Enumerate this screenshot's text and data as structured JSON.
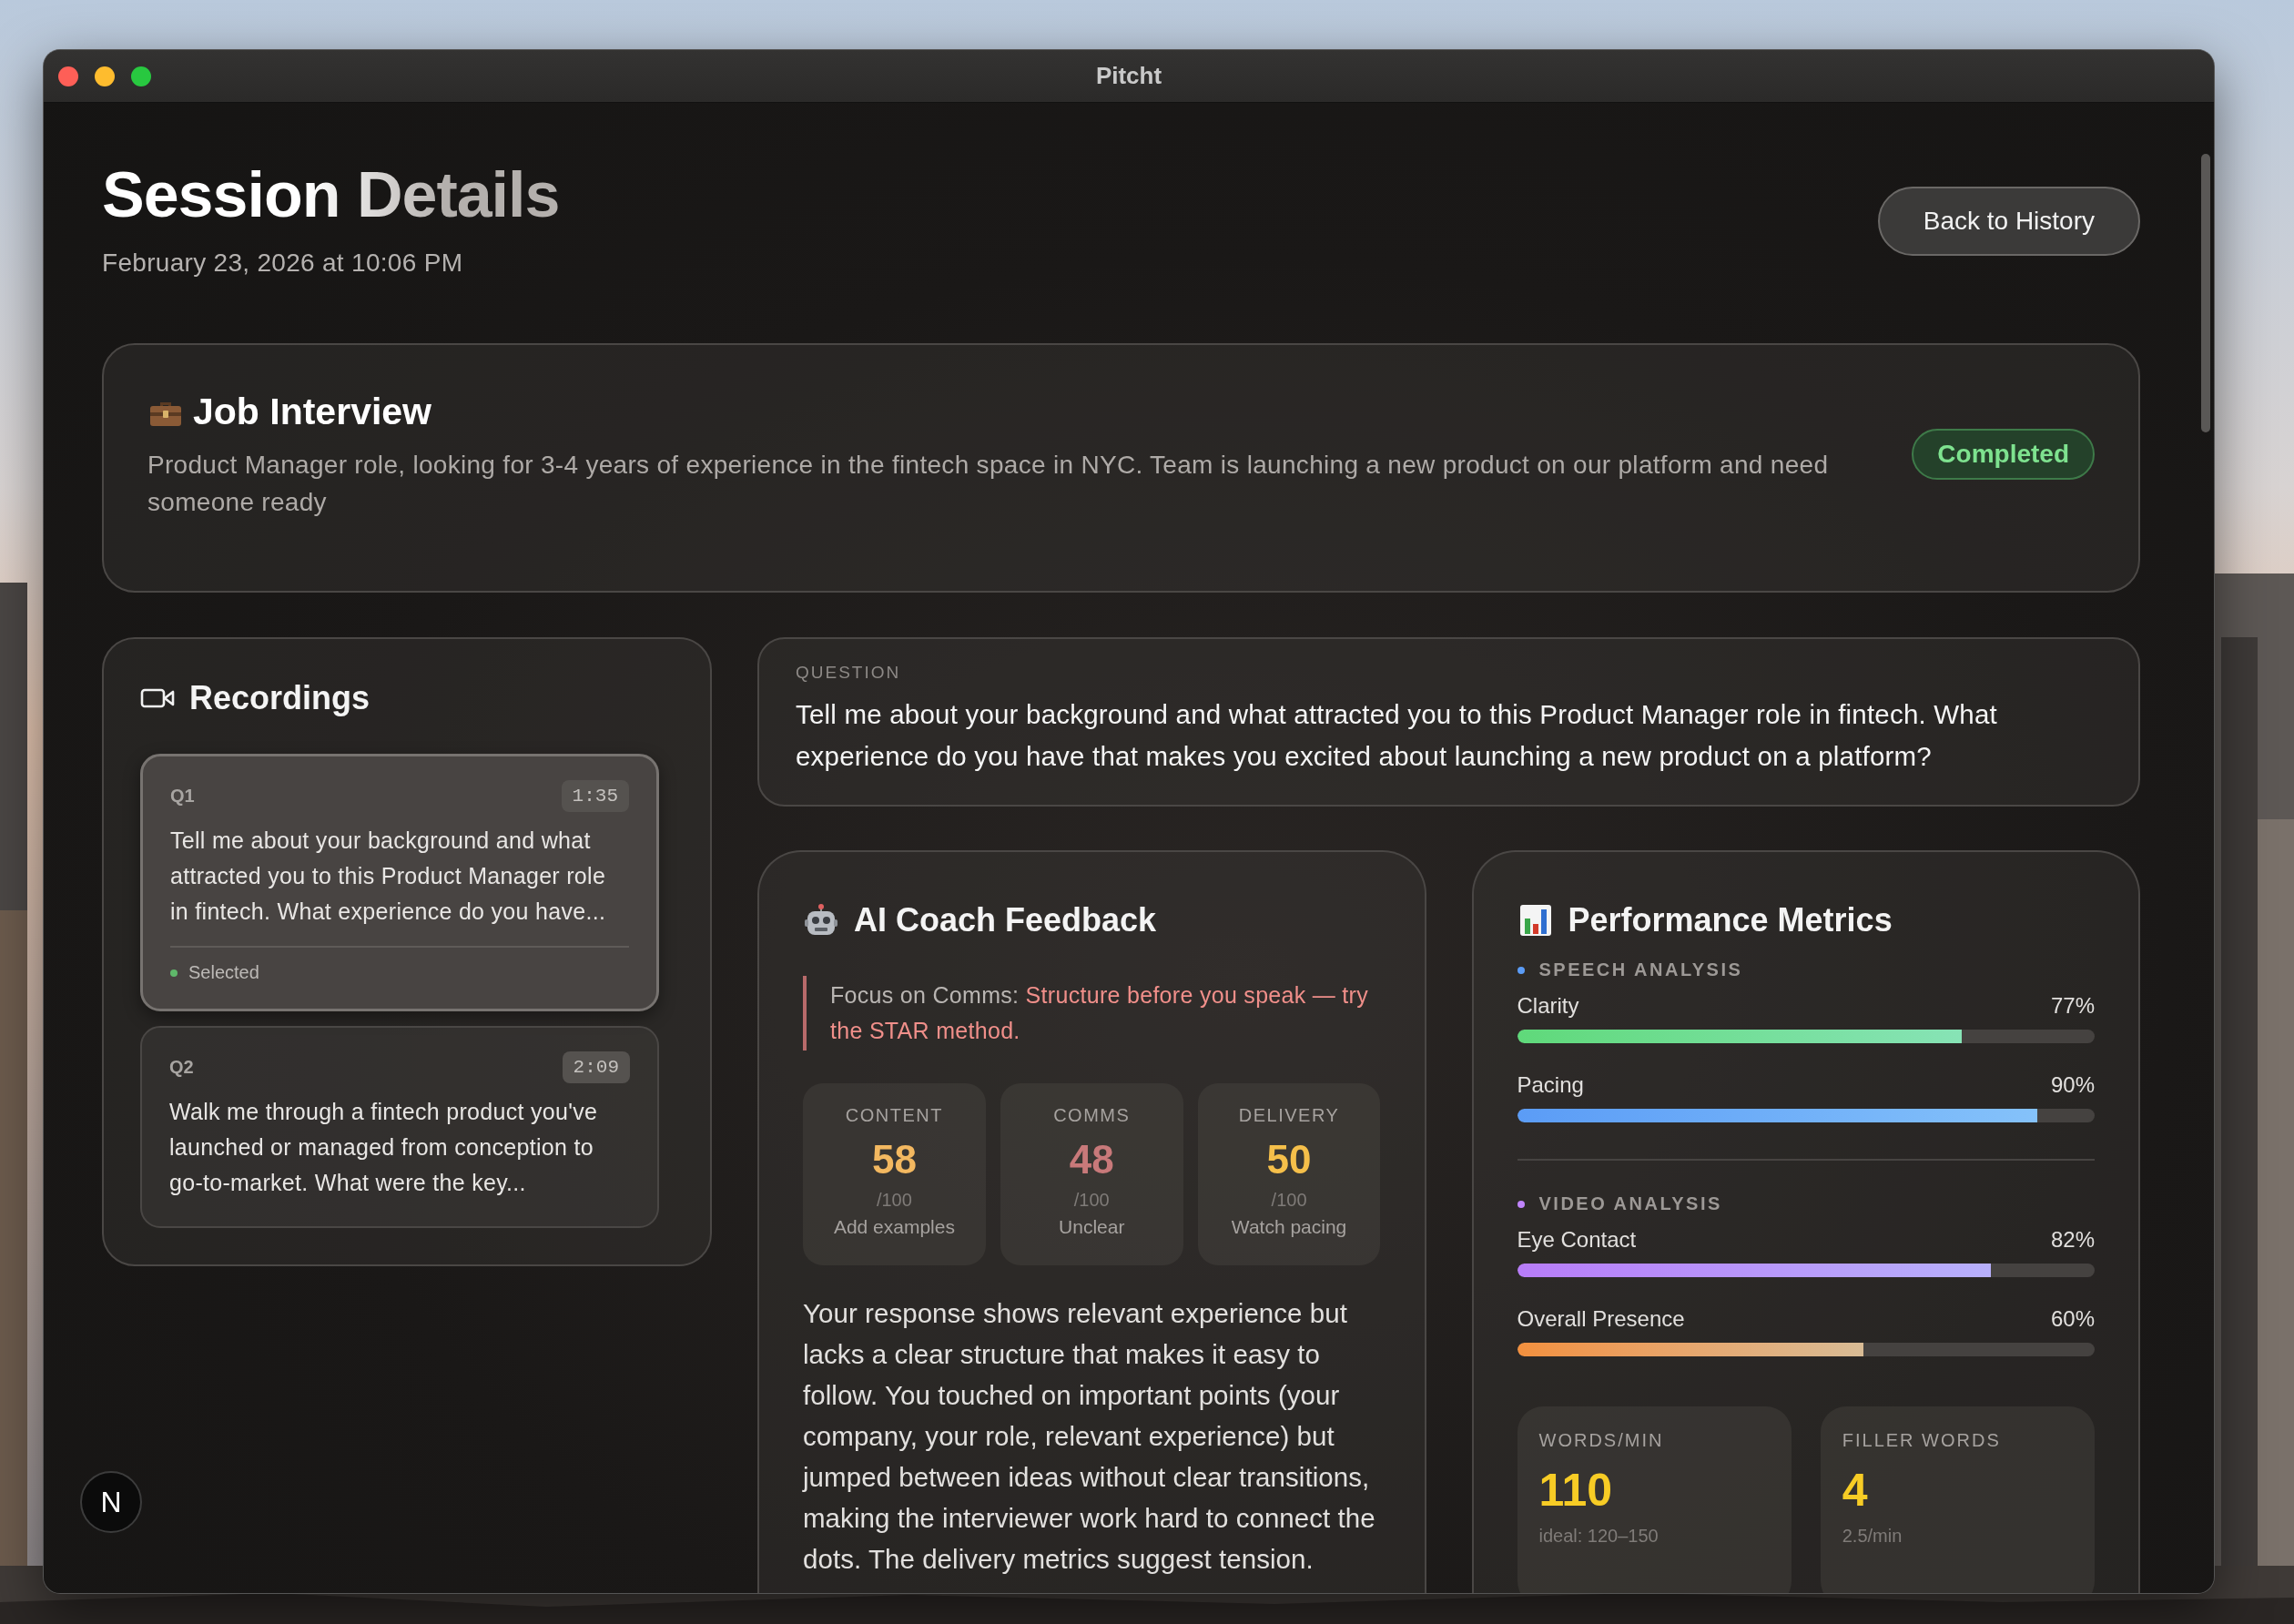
{
  "window": {
    "title": "Pitcht"
  },
  "header": {
    "title": "Session Details",
    "date": "February 23, 2026 at 10:06 PM",
    "back_button": "Back to History"
  },
  "session": {
    "title": "Job Interview",
    "description": "Product Manager role, looking for 3-4 years of experience in the fintech space in NYC. Team is launching a new product on our platform and need someone ready",
    "status": "Completed"
  },
  "recordings": {
    "title": "Recordings",
    "items": [
      {
        "number": "Q1",
        "duration": "1:35",
        "text": "Tell me about your background and what attracted you to this Product Manager role in fintech. What experience do you have...",
        "selected": true,
        "status": "Selected"
      },
      {
        "number": "Q2",
        "duration": "2:09",
        "text": "Walk me through a fintech product you've launched or managed from conception to go-to-market. What were the key...",
        "selected": false
      }
    ]
  },
  "question": {
    "label": "QUESTION",
    "text": "Tell me about your background and what attracted you to this Product Manager role in fintech. What experience do you have that makes you excited about launching a new product on a platform?"
  },
  "feedback": {
    "title": "AI Coach Feedback",
    "focus_label": "Focus on Comms:",
    "focus_text": "Structure before you speak — try the STAR method.",
    "scores": [
      {
        "label": "CONTENT",
        "value": "58",
        "max": "/100",
        "note": "Add examples",
        "color": "#f3b860"
      },
      {
        "label": "COMMS",
        "value": "48",
        "max": "/100",
        "note": "Unclear",
        "color": "#c8797a"
      },
      {
        "label": "DELIVERY",
        "value": "50",
        "max": "/100",
        "note": "Watch pacing",
        "color": "#f5bf4a"
      }
    ],
    "summary": "Your response shows relevant experience but lacks a clear structure that makes it easy to follow. You touched on important points (your company, your role, relevant experience) but jumped between ideas without clear transitions, making the interviewer work hard to connect the dots. The delivery metrics suggest tension."
  },
  "metrics": {
    "title": "Performance Metrics",
    "groups": [
      {
        "title": "SPEECH ANALYSIS",
        "color": "#5b9cf6",
        "bars": [
          {
            "name": "Clarity",
            "reading": "77%",
            "level": 0.77,
            "color": "#5fd97a"
          },
          {
            "name": "Pacing",
            "reading": "90%",
            "level": 0.9,
            "color": "#5b9cf6"
          }
        ]
      },
      {
        "title": "VIDEO ANALYSIS",
        "color": "#c084fc",
        "bars": [
          {
            "name": "Eye Contact",
            "reading": "82%",
            "level": 0.82,
            "color": "#b77cf8"
          },
          {
            "name": "Overall Presence",
            "reading": "60%",
            "level": 0.6,
            "color": "#f2903e"
          }
        ]
      }
    ],
    "stats": [
      {
        "label": "WORDS/MIN",
        "value": "110",
        "note": "ideal: 120–150"
      },
      {
        "label": "FILLER WORDS",
        "value": "4",
        "note": "2.5/min"
      }
    ]
  },
  "dev_badge": "N"
}
